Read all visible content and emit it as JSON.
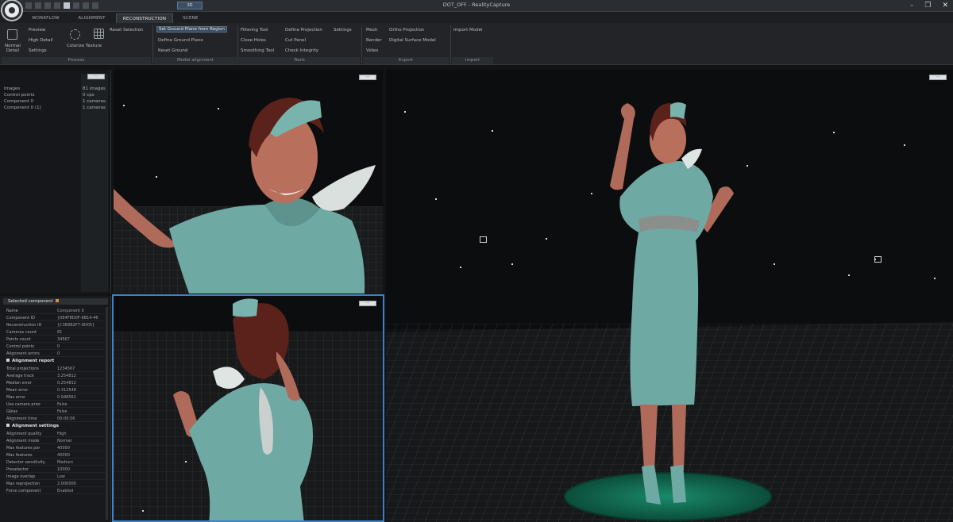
{
  "window": {
    "title": "DOT_OFF - RealityCapture",
    "mini_tab": "3D",
    "controls": [
      "–",
      "❐",
      "✕"
    ]
  },
  "tabs": [
    {
      "label": "WORKFLOW",
      "active": false
    },
    {
      "label": "ALIGNMENT",
      "active": false
    },
    {
      "label": "RECONSTRUCTION",
      "active": true
    },
    {
      "label": "SCENE",
      "active": false
    }
  ],
  "ribbon": {
    "process": {
      "label": "Process",
      "big_button": "Normal Detail",
      "items": [
        "Preview",
        "High Detail",
        "Settings"
      ],
      "component_tools": "Colorize Texture",
      "reset": "Reset Selection"
    },
    "model_alignment": {
      "label": "Model alignment",
      "items": [
        "Set Ground Plane from Region",
        "Define Ground Plane",
        "Reset Ground"
      ]
    },
    "tools": {
      "label": "Tools",
      "col1": [
        "Filtering Tool",
        "Close Holes",
        "Smoothing Tool"
      ],
      "col2": [
        "Define Projection",
        "Cut Panel",
        "Check Integrity"
      ],
      "col3": [
        "Settings",
        "Tools",
        "Tools"
      ]
    },
    "export": {
      "label": "Export",
      "col1": [
        "Mesh",
        "Render",
        "Video"
      ],
      "col2": [
        "Ortho Projection",
        "Digital Surface Model"
      ]
    },
    "import": {
      "label": "Import",
      "col1": [
        "Import Model"
      ]
    }
  },
  "left_tree": {
    "button": "···",
    "rows": [
      {
        "label": "Images",
        "value": "81 images"
      },
      {
        "label": "Control points",
        "value": "0 cps"
      },
      {
        "label": "Component 0",
        "value": "1 cameras"
      },
      {
        "label": "Component 0 (1)",
        "value": "1 cameras"
      }
    ]
  },
  "selected_component": {
    "header": "Selected component",
    "rows": [
      {
        "k": "Name",
        "v": "Component 0"
      },
      {
        "k": "Component ID",
        "v": "{0E4F8D0F-6B14-46"
      },
      {
        "k": "Reconstruction ID",
        "v": "{C3E8B2F7-9D05}"
      },
      {
        "k": "Cameras count",
        "v": "81"
      },
      {
        "k": "Points count",
        "v": "34567"
      },
      {
        "k": "Control points",
        "v": "0"
      },
      {
        "k": "Alignment errors",
        "v": "0"
      }
    ],
    "group1": "Alignment report",
    "group1_rows": [
      {
        "k": "Total projections",
        "v": "1234567"
      },
      {
        "k": "Average track",
        "v": "3.254812"
      },
      {
        "k": "Median error",
        "v": "0.254812"
      },
      {
        "k": "Mean error",
        "v": "0.312548"
      },
      {
        "k": "Max error",
        "v": "0.948561"
      },
      {
        "k": "Use camera prior",
        "v": "False"
      },
      {
        "k": "Gbias",
        "v": "False"
      },
      {
        "k": "Alignment time",
        "v": "00:00:56"
      }
    ],
    "group2": "Alignment settings",
    "group2_rows": [
      {
        "k": "Alignment quality",
        "v": "High"
      },
      {
        "k": "Alignment mode",
        "v": "Normal"
      },
      {
        "k": "Max features per",
        "v": "40000"
      },
      {
        "k": "Max features",
        "v": "40000"
      },
      {
        "k": "Detector sensitivity",
        "v": "Medium"
      },
      {
        "k": "Preselector",
        "v": "10000"
      },
      {
        "k": "Image overlap",
        "v": "Low"
      },
      {
        "k": "Max reprojection",
        "v": "2.000000"
      },
      {
        "k": "Force component",
        "v": "Enabled"
      }
    ]
  },
  "viewports": {
    "top_left_button": "···",
    "bottom_left_button": "···",
    "main_button": "···"
  },
  "colors": {
    "accent": "#3b82c9",
    "background": "#0c0d0e",
    "dress": "#6fa9a3",
    "base": "#0f6b52"
  }
}
